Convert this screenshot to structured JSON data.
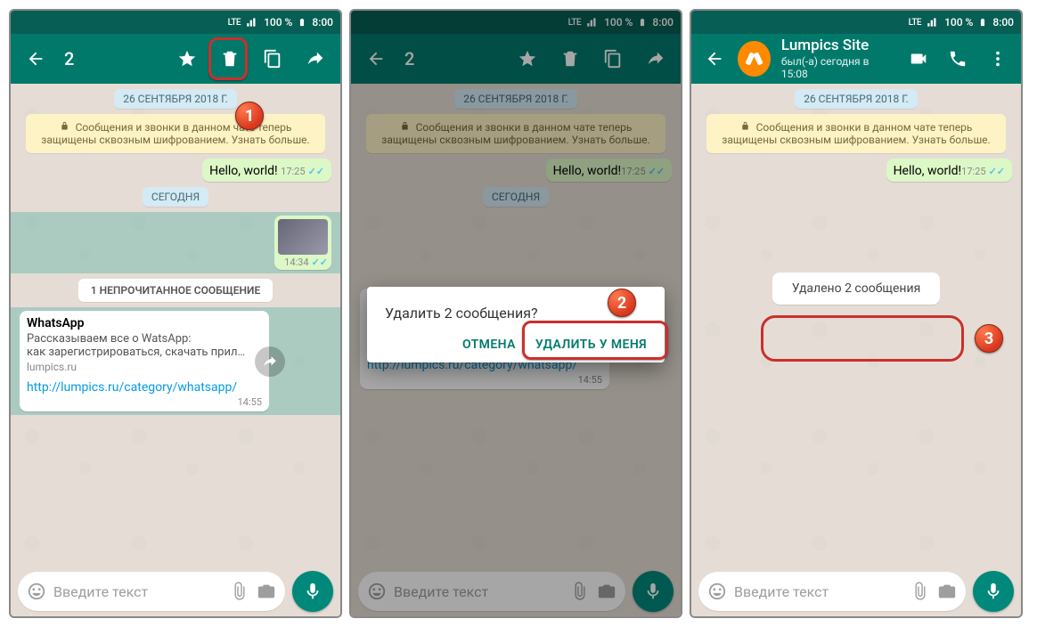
{
  "status": {
    "lte": "LTE",
    "signal": "▲",
    "battery_pct": "100 %",
    "time": "8:00"
  },
  "selection": {
    "count": "2"
  },
  "contact": {
    "name": "Lumpics Site",
    "last_seen": "был(-а) сегодня в 15:08"
  },
  "date_pill": "26 СЕНТЯБРЯ 2018 Г.",
  "encryption": "Сообщения и звонки в данном чате теперь защищены сквозным шифрованием. Узнать больше.",
  "hello": {
    "text": "Hello, world!",
    "time": "17:25"
  },
  "today_pill": "СЕГОДНЯ",
  "image_msg_time": "14:34",
  "unread_banner": "1 НЕПРОЧИТАННОЕ СООБЩЕНИЕ",
  "link_msg": {
    "title": "WhatsApp",
    "desc12": "Рассказываем все о WatsApp:\nкак зарегистрироваться, скачать прил…",
    "desc3": "Рассказываем все о WatsApp:\nкак зарегистрироваться, скачать прил…",
    "site": "lumpics.ru",
    "url": "http://lumpics.ru/category/whatsapp/",
    "time": "14:55"
  },
  "input_placeholder": "Введите текст",
  "dialog": {
    "question": "Удалить 2 сообщения?",
    "cancel": "ОТМЕНА",
    "delete_me": "УДАЛИТЬ У МЕНЯ"
  },
  "deleted_toast": "Удалено 2 сообщения",
  "badges": {
    "b1": "1",
    "b2": "2",
    "b3": "3"
  }
}
